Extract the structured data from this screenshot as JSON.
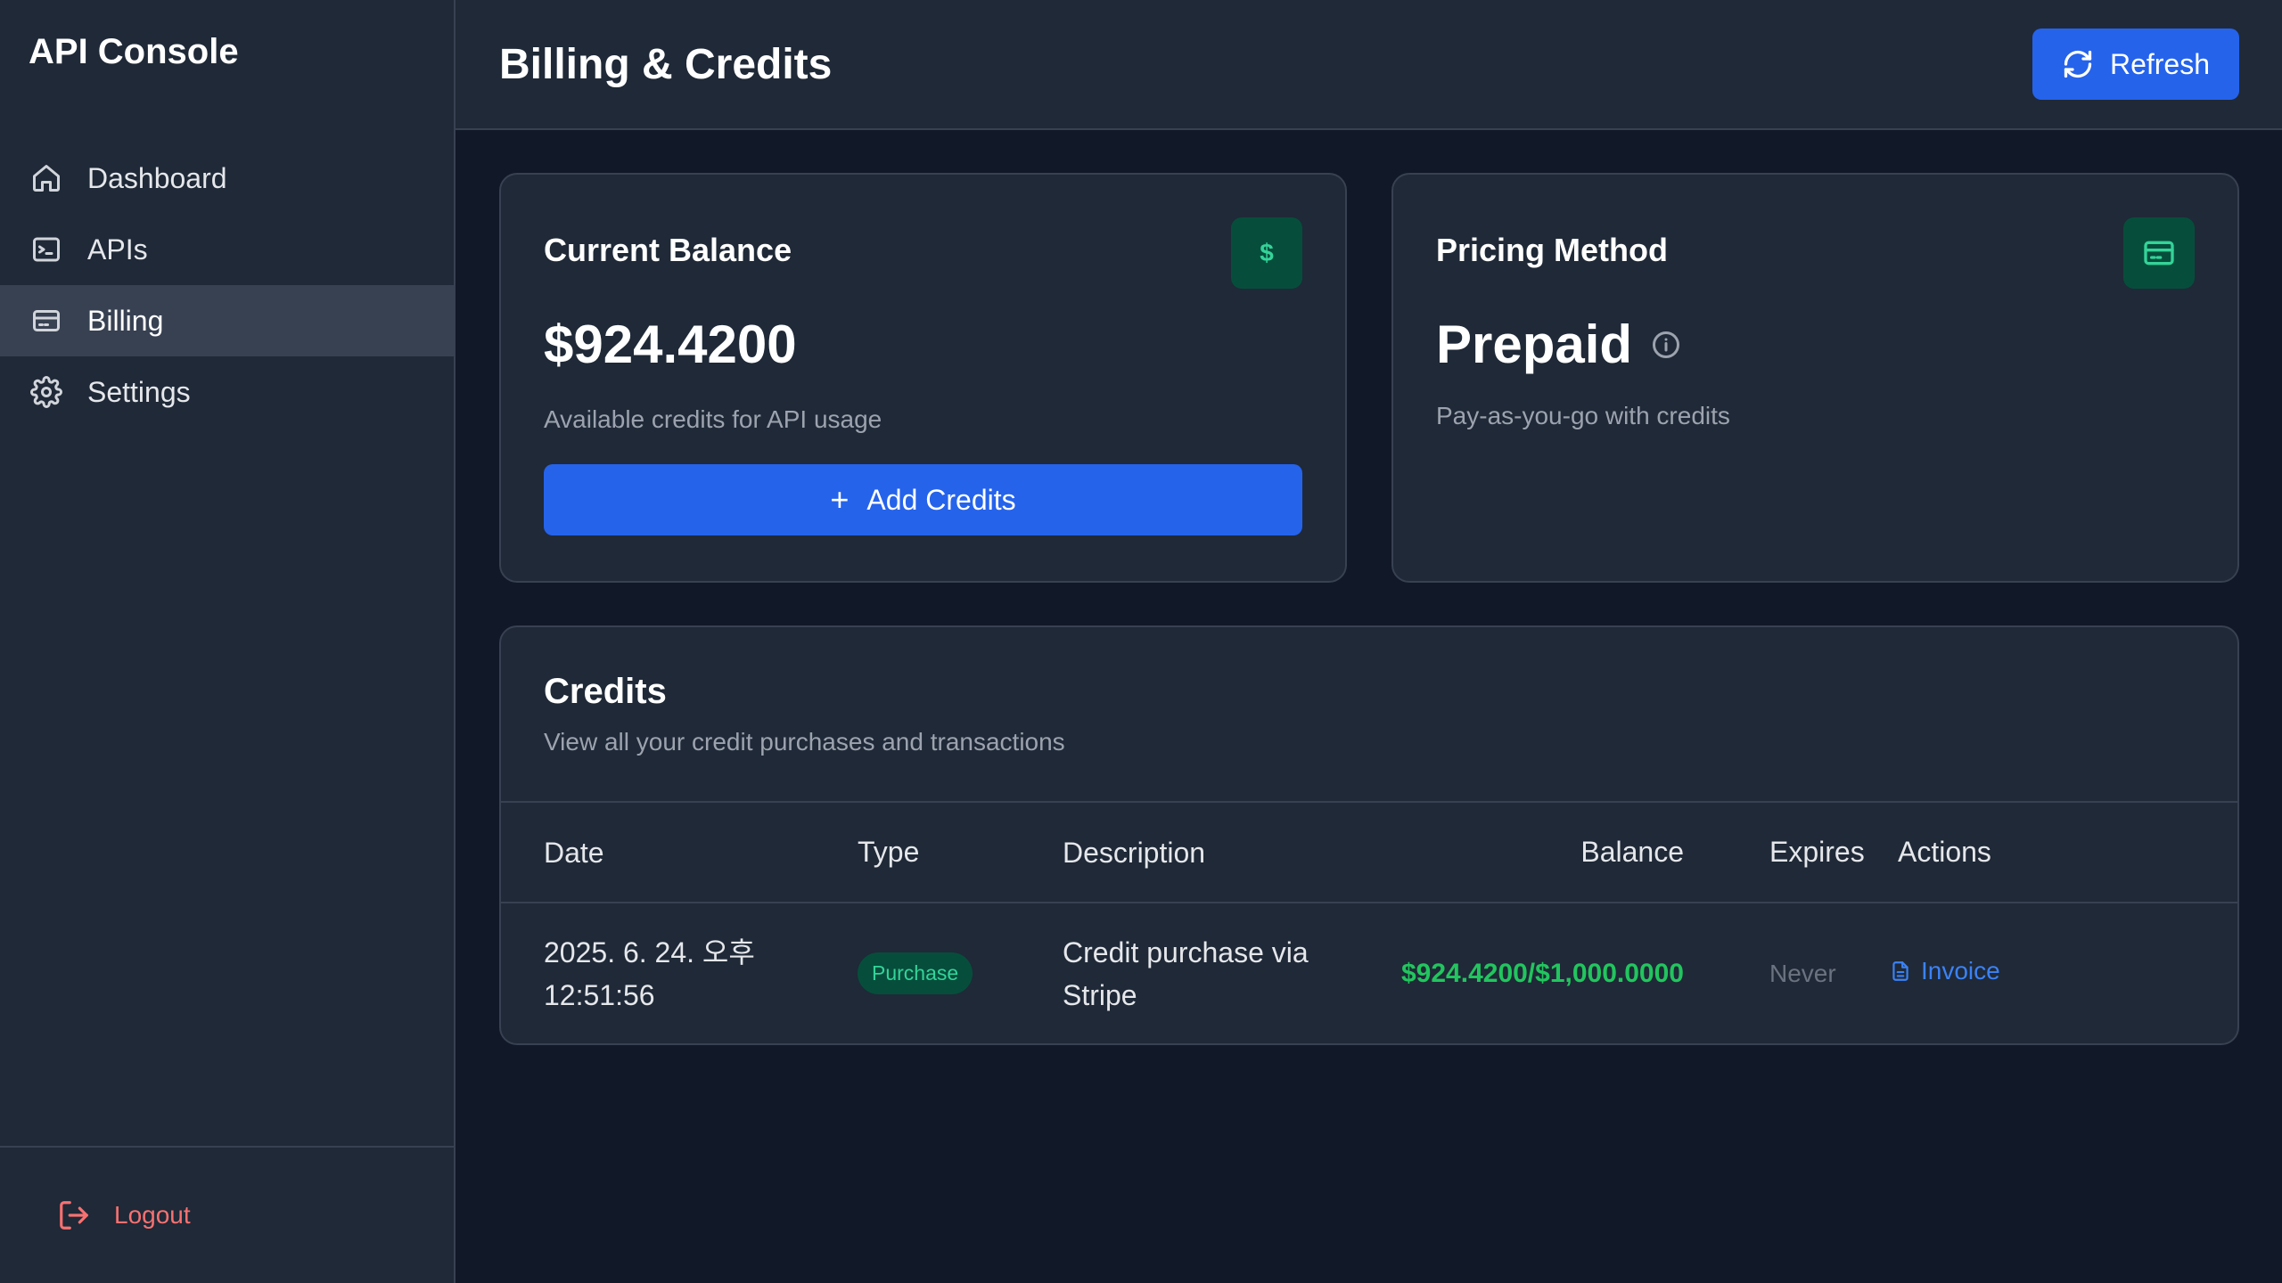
{
  "app": {
    "brand": "API Console"
  },
  "sidebar": {
    "items": [
      {
        "label": "Dashboard",
        "icon": "home-icon",
        "active": false
      },
      {
        "label": "APIs",
        "icon": "terminal-icon",
        "active": false
      },
      {
        "label": "Billing",
        "icon": "credit-card-icon",
        "active": true
      },
      {
        "label": "Settings",
        "icon": "gear-icon",
        "active": false
      }
    ],
    "logout_label": "Logout"
  },
  "header": {
    "title": "Billing & Credits",
    "refresh_label": "Refresh"
  },
  "balance_card": {
    "title": "Current Balance",
    "badge": "$",
    "amount": "$924.4200",
    "subtitle": "Available credits for API usage",
    "add_label": "Add Credits"
  },
  "pricing_card": {
    "title": "Pricing Method",
    "value": "Prepaid",
    "subtitle": "Pay-as-you-go with credits"
  },
  "credits": {
    "title": "Credits",
    "subtitle": "View all your credit purchases and transactions",
    "columns": [
      "Date",
      "Type",
      "Description",
      "Balance",
      "Expires",
      "Actions"
    ],
    "rows": [
      {
        "date_line1": "2025. 6. 24. 오후",
        "date_line2": "12:51:56",
        "type": "Purchase",
        "desc_line1": "Credit purchase via",
        "desc_line2": "Stripe",
        "balance": "$924.4200/$1,000.0000",
        "expires": "Never",
        "action": "Invoice"
      }
    ]
  },
  "colors": {
    "accent": "#2563eb",
    "success": "#22c55e",
    "danger": "#f87171",
    "background": "#111827",
    "panel": "#1f2937"
  }
}
